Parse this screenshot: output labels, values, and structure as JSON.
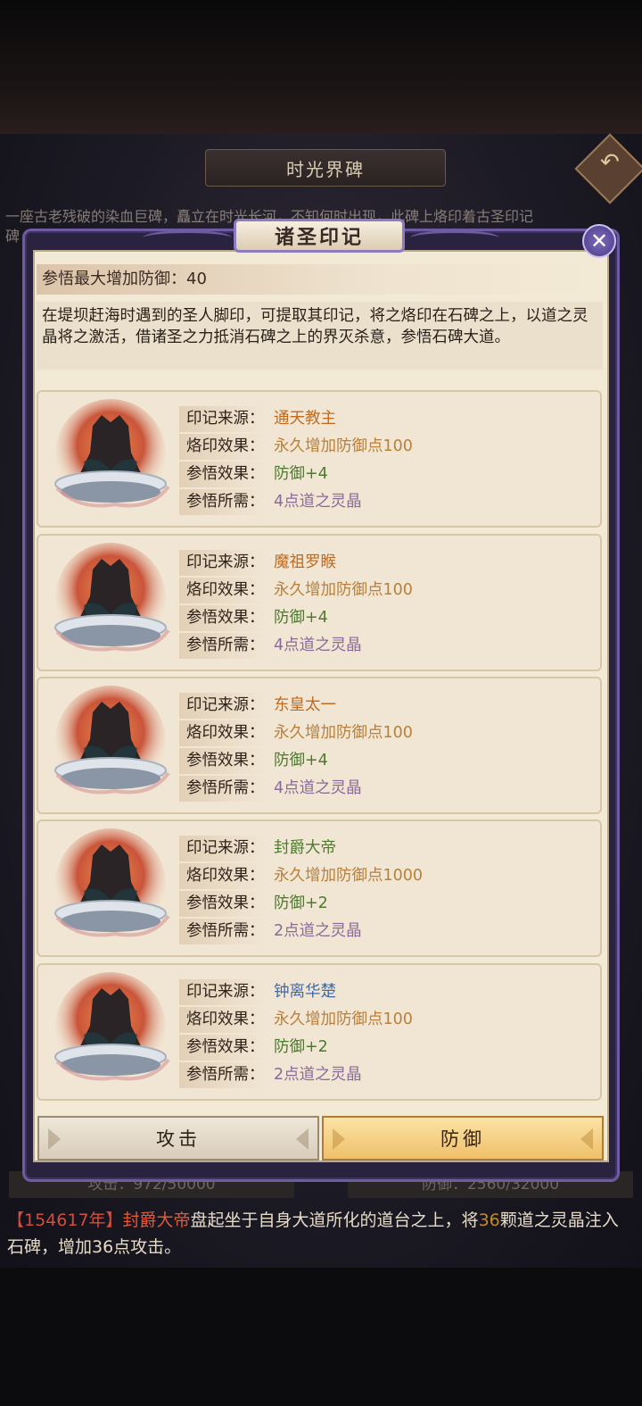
{
  "background": {
    "title": "时光界碑",
    "back_icon": "undo-arrow-icon",
    "story_line1": "一座古老残破的染血巨碑，矗立在时光长河，不知何时出现，此碑上烙印着古圣印记",
    "story_line2": "碑",
    "stat_attack": "攻击：972/50000",
    "stat_defense": "防御：2560/32000",
    "log": {
      "year": "【154617年】",
      "name": "封爵大帝",
      "text1": "盘起坐于自身大道所化的道台之上，将",
      "count": "36",
      "text2": "颗道之灵晶注入石碑，增加36点攻击。"
    }
  },
  "dialog": {
    "title": "诸圣印记",
    "close_icon": "close-x-icon",
    "max_label": "参悟最大增加防御：40",
    "description": "在堤坝赶海时遇到的圣人脚印，可提取其印记，将之烙印在石碑之上，以道之灵晶将之激活，借诸圣之力抵消石碑之上的界灭杀意，参悟石碑大道。",
    "labels": {
      "source": "印记来源：",
      "effect": "烙印效果：",
      "insight": "参悟效果：",
      "cost": "参悟所需："
    },
    "cards": [
      {
        "source": "通天教主",
        "effect": "永久增加防御点100",
        "insight": "防御+4",
        "cost": "4点道之灵晶"
      },
      {
        "source": "魔祖罗睺",
        "effect": "永久增加防御点100",
        "insight": "防御+4",
        "cost": "4点道之灵晶"
      },
      {
        "source": "东皇太一",
        "effect": "永久增加防御点100",
        "insight": "防御+4",
        "cost": "4点道之灵晶"
      },
      {
        "source": "封爵大帝",
        "effect": "永久增加防御点1000",
        "insight": "防御+2",
        "cost": "2点道之灵晶"
      },
      {
        "source": "钟离华楚",
        "effect": "永久增加防御点100",
        "insight": "防御+2",
        "cost": "2点道之灵晶"
      }
    ],
    "tabs": {
      "attack": "攻击",
      "defense": "防御",
      "selected": "防御"
    }
  }
}
